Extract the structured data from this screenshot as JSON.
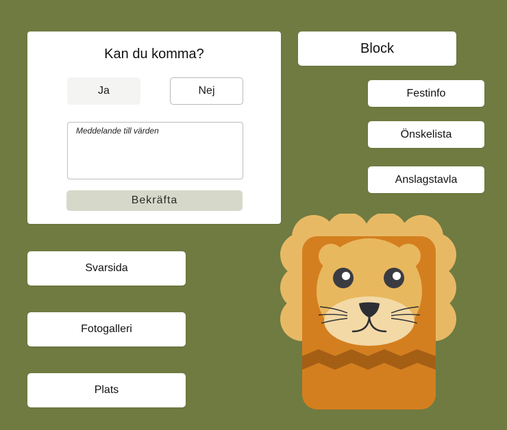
{
  "rsvp": {
    "title": "Kan du komma?",
    "yes_label": "Ja",
    "no_label": "Nej",
    "message_placeholder": "Meddelande till värden",
    "confirm_label": "Bekräfta"
  },
  "nav_right": {
    "block_label": "Block",
    "festinfo_label": "Festinfo",
    "wishlist_label": "Önskelista",
    "noticeboard_label": "Anslagstavla"
  },
  "nav_left": {
    "reply_page_label": "Svarsida",
    "gallery_label": "Fotogalleri",
    "location_label": "Plats"
  },
  "colors": {
    "background": "#6f7b41",
    "card": "#ffffff",
    "confirm_button": "#d6d9c9",
    "lion_mane": "#e8b965",
    "lion_body": "#d47f1f",
    "lion_face": "#e8b85e",
    "lion_stripe": "#a45f15"
  },
  "illustration": {
    "name": "lion-illustration"
  }
}
